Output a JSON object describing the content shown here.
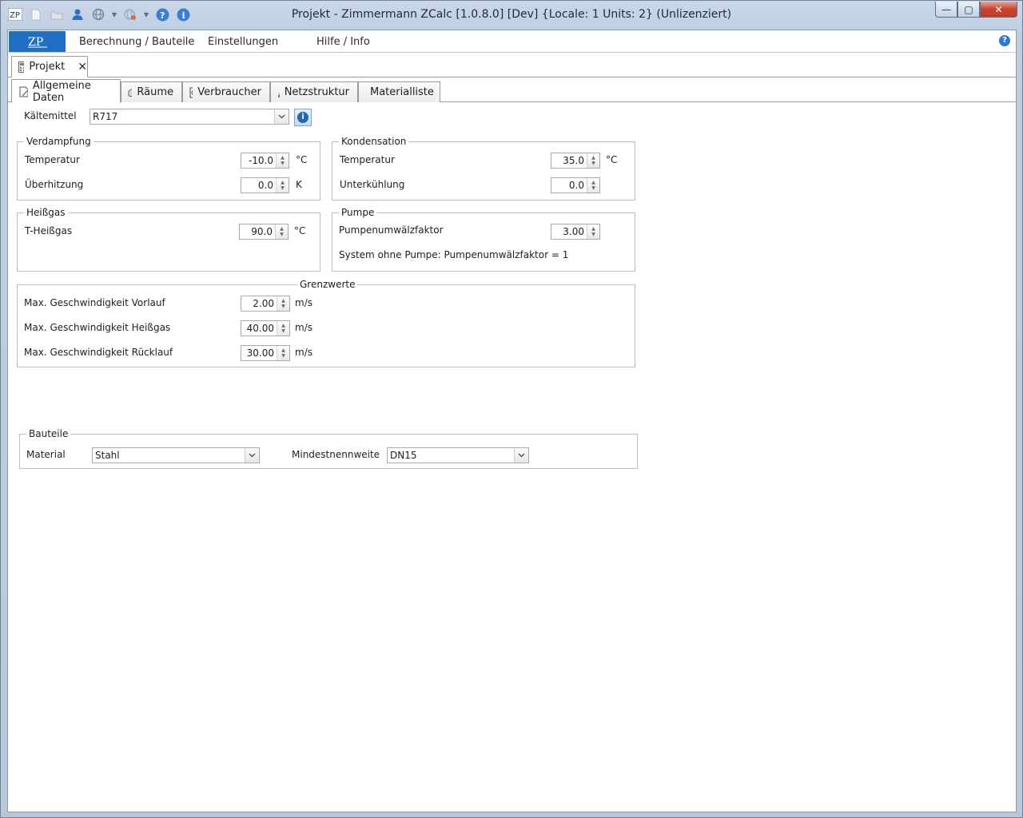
{
  "window": {
    "title": "Projekt - Zimmermann ZCalc [1.0.8.0] [Dev] {Locale: 1 Units: 2} (Unlizenziert)",
    "minimize": "—",
    "maximize": "▢",
    "close": "✕"
  },
  "menu": {
    "items": [
      "Berechnung / Bauteile",
      "Einstellungen",
      "Hilfe / Info"
    ]
  },
  "doc_tab": {
    "label": "Projekt",
    "close": "✕"
  },
  "tabs": [
    "Allgemeine Daten",
    "Räume",
    "Verbraucher",
    "Netzstruktur",
    "Materialliste"
  ],
  "refrigerant": {
    "label": "Kältemittel",
    "value": "R717"
  },
  "evaporation": {
    "title": "Verdampfung",
    "temp_label": "Temperatur",
    "temp_value": "-10.0",
    "temp_unit": "°C",
    "superheat_label": "Überhitzung",
    "superheat_value": "0.0",
    "superheat_unit": "K"
  },
  "condensation": {
    "title": "Kondensation",
    "temp_label": "Temperatur",
    "temp_value": "35.0",
    "temp_unit": "°C",
    "subcool_label": "Unterkühlung",
    "subcool_value": "0.0"
  },
  "hotgas": {
    "title": "Heißgas",
    "temp_label": "T-Heißgas",
    "temp_value": "90.0",
    "temp_unit": "°C"
  },
  "pump": {
    "title": "Pumpe",
    "factor_label": "Pumpenumwälzfaktor",
    "factor_value": "3.00",
    "note": "System ohne Pumpe: Pumpenumwälzfaktor = 1"
  },
  "limits": {
    "title": "Grenzwerte",
    "rows": [
      {
        "label": "Max. Geschwindigkeit Vorlauf",
        "value": "2.00",
        "unit": "m/s"
      },
      {
        "label": "Max. Geschwindigkeit Heißgas",
        "value": "40.00",
        "unit": "m/s"
      },
      {
        "label": "Max. Geschwindigkeit Rücklauf",
        "value": "30.00",
        "unit": "m/s"
      }
    ]
  },
  "components": {
    "title": "Bauteile",
    "material_label": "Material",
    "material_value": "Stahl",
    "min_dn_label": "Mindestnennweite",
    "min_dn_value": "DN15"
  },
  "colors": {
    "accent": "#1f6fc5",
    "close": "#c7432e",
    "border": "#bcbcbc"
  }
}
